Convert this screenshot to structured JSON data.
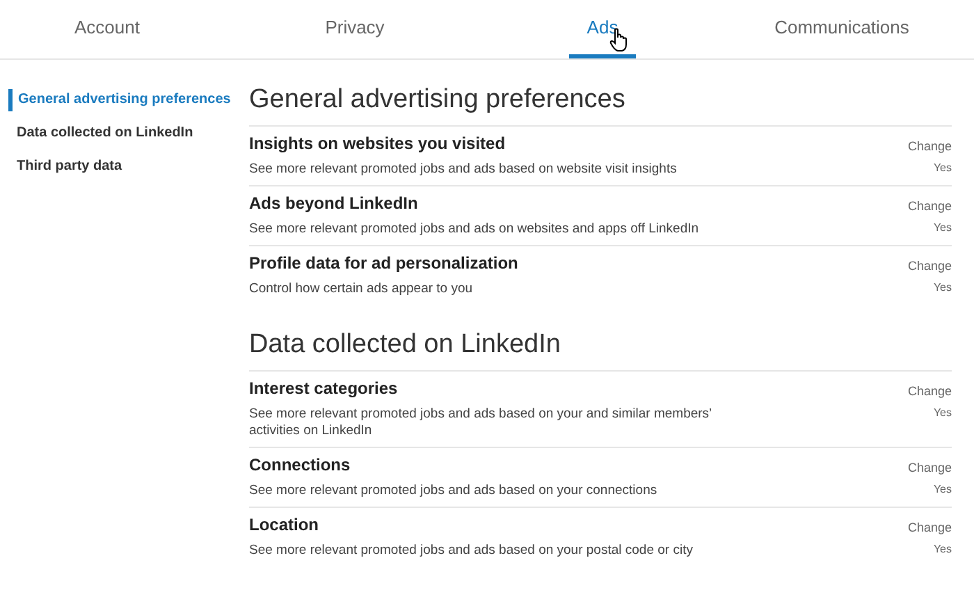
{
  "tabs": [
    {
      "label": "Account",
      "selected": false
    },
    {
      "label": "Privacy",
      "selected": false
    },
    {
      "label": "Ads",
      "selected": true
    },
    {
      "label": "Communications",
      "selected": false
    }
  ],
  "sidebar": {
    "items": [
      {
        "label": "General advertising preferences",
        "selected": true
      },
      {
        "label": "Data collected on LinkedIn",
        "selected": false
      },
      {
        "label": "Third party data",
        "selected": false
      }
    ]
  },
  "sections": [
    {
      "title": "General advertising preferences",
      "settings": [
        {
          "title": "Insights on websites you visited",
          "description": "See more relevant promoted jobs and ads based on website visit insights",
          "action": "Change",
          "value": "Yes"
        },
        {
          "title": "Ads beyond LinkedIn",
          "description": "See more relevant promoted jobs and ads on websites and apps off LinkedIn",
          "action": "Change",
          "value": "Yes"
        },
        {
          "title": "Profile data for ad personalization",
          "description": "Control how certain ads appear to you",
          "action": "Change",
          "value": "Yes"
        }
      ]
    },
    {
      "title": "Data collected on LinkedIn",
      "settings": [
        {
          "title": "Interest categories",
          "description": "See more relevant promoted jobs and ads based on your and similar members’ activities on LinkedIn",
          "action": "Change",
          "value": "Yes"
        },
        {
          "title": "Connections",
          "description": "See more relevant promoted jobs and ads based on your connections",
          "action": "Change",
          "value": "Yes"
        },
        {
          "title": "Location",
          "description": "See more relevant promoted jobs and ads based on your postal code or city",
          "action": "Change",
          "value": "Yes"
        }
      ]
    }
  ]
}
